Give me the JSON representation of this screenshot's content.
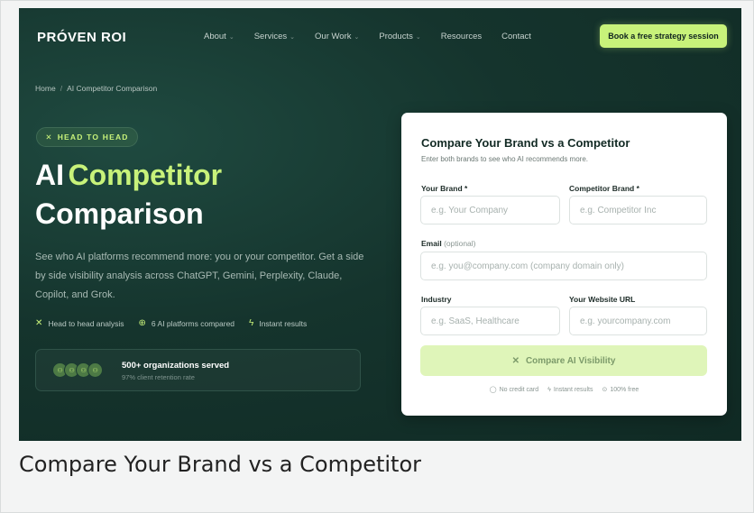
{
  "header": {
    "logo": "PRÓVEN ROI",
    "menu": [
      {
        "label": "About",
        "dropdown": true
      },
      {
        "label": "Services",
        "dropdown": true
      },
      {
        "label": "Our Work",
        "dropdown": true
      },
      {
        "label": "Products",
        "dropdown": true
      },
      {
        "label": "Resources",
        "dropdown": false
      },
      {
        "label": "Contact",
        "dropdown": false
      }
    ],
    "cta": "Book a free strategy session"
  },
  "breadcrumb": {
    "home": "Home",
    "separator": "/",
    "current": "AI Competitor Comparison"
  },
  "hero": {
    "pill": "HEAD TO HEAD",
    "title_part1": "AI",
    "title_accent": "Competitor",
    "title_line2": "Comparison",
    "lead": "See who AI platforms recommend more: you or your competitor. Get a side by side visibility analysis across ChatGPT, Gemini, Perplexity, Claude, Copilot, and Grok.",
    "features": [
      {
        "icon": "swords-icon",
        "label": "Head to head analysis"
      },
      {
        "icon": "globe-icon",
        "label": "6 AI platforms compared"
      },
      {
        "icon": "bolt-icon",
        "label": "Instant results"
      }
    ],
    "stat": {
      "title": "500+ organizations served",
      "subtitle": "97% client retention rate"
    }
  },
  "form": {
    "title": "Compare Your Brand vs a Competitor",
    "subtitle": "Enter both brands to see who AI recommends more.",
    "brand_label": "Your Brand *",
    "brand_placeholder": "e.g. Your Company",
    "competitor_label": "Competitor Brand *",
    "competitor_placeholder": "e.g. Competitor Inc",
    "email_label": "Email",
    "email_optional": "(optional)",
    "email_placeholder": "e.g. you@company.com (company domain only)",
    "industry_label": "Industry",
    "industry_placeholder": "e.g. SaaS, Healthcare",
    "website_label": "Your Website URL",
    "website_placeholder": "e.g. yourcompany.com",
    "submit_label": "Compare AI Visibility",
    "trust": [
      "No credit card",
      "Instant results",
      "100% free"
    ]
  },
  "caption": "Compare Your Brand vs a Competitor",
  "colors": {
    "accent": "#c8f27a",
    "background": "#15342d",
    "card": "#ffffff"
  }
}
